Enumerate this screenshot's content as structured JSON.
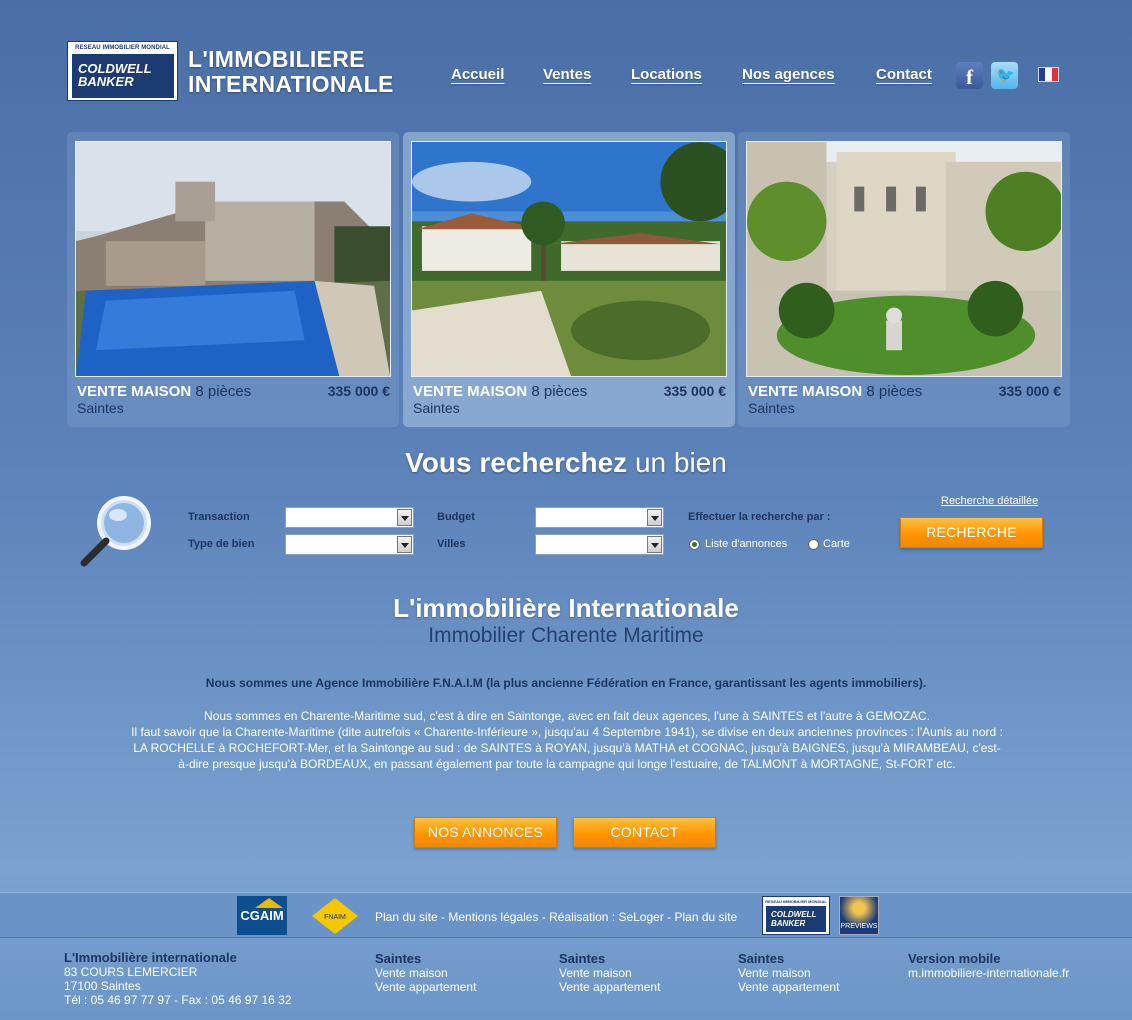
{
  "header": {
    "logo": {
      "top_text": "RESEAU IMMOBILIER MONDIAL",
      "line1": "COLDWELL",
      "line2": "BANKER"
    },
    "title_line1": "L'IMMOBILIERE",
    "title_line2": "INTERNATIONALE",
    "nav": [
      "Accueil",
      "Ventes",
      "Locations",
      "Nos agences",
      "Contact"
    ],
    "social": [
      "facebook-icon",
      "twitter-icon"
    ],
    "language": "french-flag-icon"
  },
  "listings": [
    {
      "type": "VENTE MAISON",
      "rooms": "8 pièces",
      "price": "335 000 €",
      "city": "Saintes"
    },
    {
      "type": "VENTE MAISON",
      "rooms": "8 pièces",
      "price": "335 000 €",
      "city": "Saintes"
    },
    {
      "type": "VENTE MAISON",
      "rooms": "8 pièces",
      "price": "335 000 €",
      "city": "Saintes"
    }
  ],
  "search": {
    "title_bold": "Vous recherchez",
    "title_rest": "un bien",
    "labels": {
      "transaction": "Transaction",
      "type": "Type de bien",
      "budget": "Budget",
      "villes": "Villes",
      "mode": "Effectuer la recherche par :"
    },
    "options": {
      "list": "Liste d'annonces",
      "map": "Carte"
    },
    "detail_link": "Recherche détaillée",
    "button": "RECHERCHE"
  },
  "intro": {
    "title": "L'immobilière Internationale",
    "subtitle": "Immobilier Charente Maritime",
    "p1": "Nous sommes une Agence Immobilière F.N.A.I.M (la plus ancienne Fédération en France, garantissant les agents immobiliers).",
    "p2_l1": "Nous sommes en Charente-Maritime sud, c'est à dire en Saintonge, avec en fait deux agences, l'une à SAINTES et l'autre à GEMOZAC.",
    "p2_l2": "Il faut savoir que la Charente-Maritime (dite autrefois « Charente-Inférieure », jusqu'au 4 Septembre 1941), se divise en deux anciennes provinces : l'Aunis au nord :",
    "p2_l3": "LA ROCHELLE à ROCHEFORT-Mer, et la Saintonge au sud : de SAINTES à ROYAN, jusqu'à MATHA et COGNAC, jusqu'à BAIGNES, jusqu'à MIRAMBEAU, c'est-",
    "p2_l4": "à-dire presque jusqu'à BORDEAUX, en passant également par toute la campagne qui longe l'estuaire, de TALMONT à MORTAGNE, St-FORT etc.",
    "btn_annonces": "NOS ANNONCES",
    "btn_contact": "CONTACT"
  },
  "footer": {
    "logos": {
      "cgaim": "CGAIM",
      "fnaim": "FNAIM",
      "previews": "PREVIEWS"
    },
    "links": "Plan du site  -  Mentions légales  -  Réalisation : SeLoger - Plan du site",
    "company": {
      "name": "L'Immobilière internationale",
      "address": "83 COURS LEMERCIER",
      "city": "17100 Saintes",
      "phone": "Tél : 05 46 97 77 97 - Fax : 05 46 97 16 32"
    },
    "columns": [
      {
        "title": "Saintes",
        "l1": "Vente maison",
        "l2": "Vente appartement"
      },
      {
        "title": "Saintes",
        "l1": "Vente maison",
        "l2": "Vente appartement"
      },
      {
        "title": "Saintes",
        "l1": "Vente maison",
        "l2": "Vente appartement"
      }
    ],
    "mobile": {
      "title": "Version mobile",
      "url": "m.immobiliere-internationale.fr"
    }
  }
}
